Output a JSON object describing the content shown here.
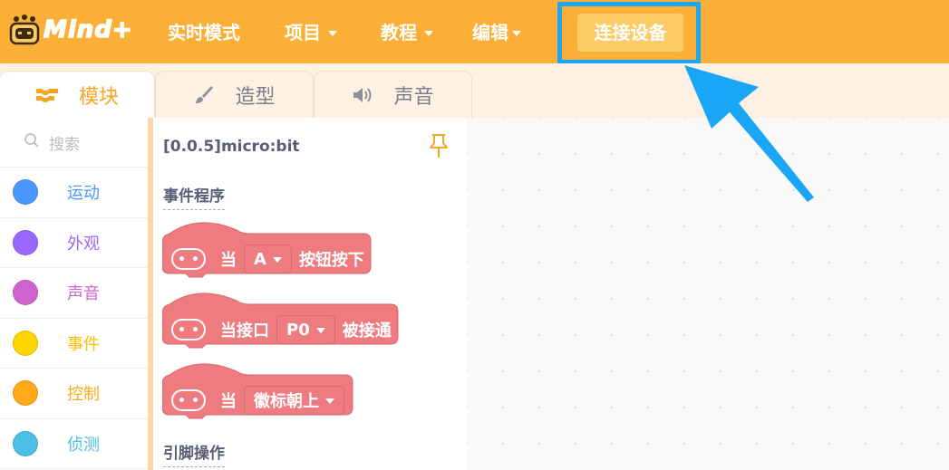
{
  "app": {
    "logo_text": "Mind+"
  },
  "menu": {
    "realtime": "实时模式",
    "project": "项目",
    "tutorial": "教程",
    "edit": "编辑",
    "connect": "连接设备"
  },
  "tabs": [
    {
      "label": "模块",
      "icon": "blocks-icon",
      "active": true
    },
    {
      "label": "造型",
      "icon": "brush-icon",
      "active": false
    },
    {
      "label": "声音",
      "icon": "speaker-icon",
      "active": false
    }
  ],
  "sidebar": {
    "search_placeholder": "搜索",
    "categories": [
      {
        "label": "运动",
        "color": "#4C97FF"
      },
      {
        "label": "外观",
        "color": "#9966FF"
      },
      {
        "label": "声音",
        "color": "#CF63CF"
      },
      {
        "label": "事件",
        "color": "#FFD500"
      },
      {
        "label": "控制",
        "color": "#FFAB19"
      },
      {
        "label": "侦测",
        "color": "#4CBFE6"
      }
    ]
  },
  "flyout": {
    "extension_title": "[0.0.5]micro:bit",
    "section_events": "事件程序",
    "section_pins": "引脚操作",
    "blocks": [
      {
        "prefix": "当",
        "dropdown": "A",
        "suffix": "按钮按下"
      },
      {
        "prefix": "当接口",
        "dropdown": "P0",
        "suffix": "被接通"
      },
      {
        "prefix": "当",
        "dropdown": "徽标朝上",
        "suffix": ""
      }
    ]
  },
  "colors": {
    "header": "#FBAF36",
    "highlight": "#1AA6F7",
    "block": "#EE7B7F"
  }
}
